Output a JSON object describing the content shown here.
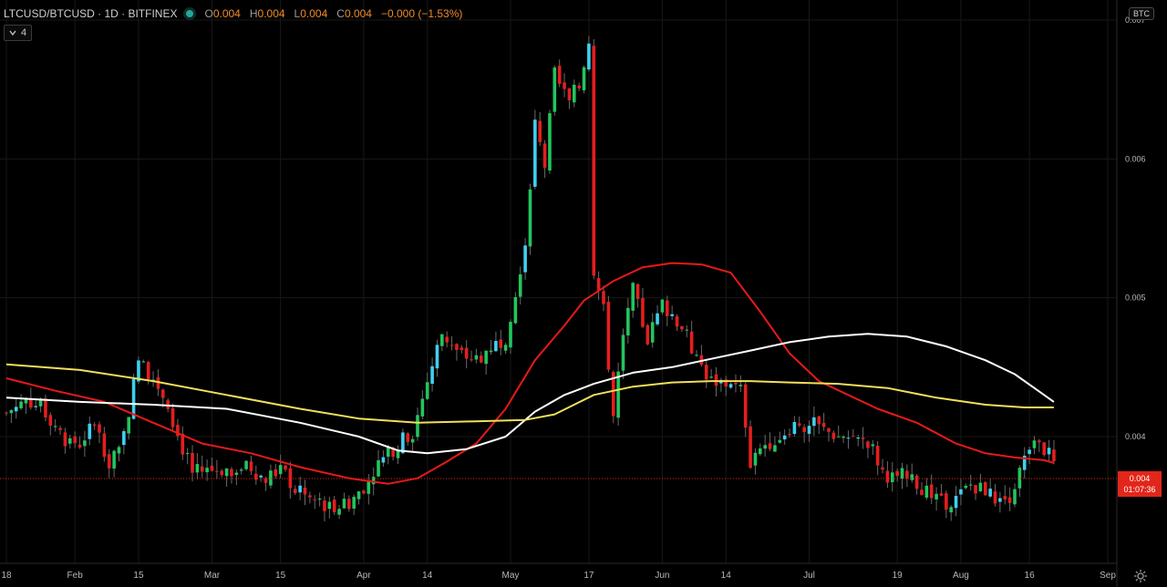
{
  "header": {
    "symbol": "LTCUSD/BTCUSD · 1D · BITFINEX",
    "ohlc": [
      {
        "label": "O",
        "value": "0.004"
      },
      {
        "label": "H",
        "value": "0.004"
      },
      {
        "label": "L",
        "value": "0.004"
      },
      {
        "label": "C",
        "value": "0.004"
      }
    ],
    "change": "−0.000 (−1.53%)"
  },
  "indicator_toggle": {
    "count": "4"
  },
  "currency_badge": "BTC",
  "last_price": {
    "price": "0.004",
    "countdown": "01:07:36"
  },
  "colors": {
    "up": "#22c55e",
    "down": "#e41e1e",
    "up_alt": "#3fd0f0",
    "ma_red": "#e81919",
    "ma_white": "#ffffff",
    "ma_yellow": "#f1df5a",
    "grid": "#181818",
    "axis_text": "#b8b8b8"
  },
  "chart_data": {
    "type": "candlestick",
    "y_axis": {
      "ticks": [
        {
          "value": 0.007,
          "label": "0.007"
        },
        {
          "value": 0.006,
          "label": "0.006"
        },
        {
          "value": 0.005,
          "label": "0.005"
        },
        {
          "value": 0.004,
          "label": "0.004"
        }
      ],
      "range": [
        0.0032,
        0.007
      ],
      "scale": "linear"
    },
    "x_axis": {
      "ticks": [
        {
          "day": 0,
          "label": "18"
        },
        {
          "day": 14,
          "label": "Feb"
        },
        {
          "day": 27,
          "label": "15"
        },
        {
          "day": 42,
          "label": "Mar"
        },
        {
          "day": 56,
          "label": "15"
        },
        {
          "day": 73,
          "label": "Apr"
        },
        {
          "day": 86,
          "label": "14"
        },
        {
          "day": 103,
          "label": "May"
        },
        {
          "day": 119,
          "label": "17"
        },
        {
          "day": 134,
          "label": "Jun"
        },
        {
          "day": 147,
          "label": "14"
        },
        {
          "day": 164,
          "label": "Jul"
        },
        {
          "day": 182,
          "label": "19"
        },
        {
          "day": 195,
          "label": "Aug"
        },
        {
          "day": 209,
          "label": "16"
        },
        {
          "day": 225,
          "label": "Sep"
        }
      ]
    },
    "close_path": [
      [
        0,
        0.00417
      ],
      [
        4,
        0.00428
      ],
      [
        8,
        0.00418
      ],
      [
        12,
        0.00398
      ],
      [
        15,
        0.00395
      ],
      [
        18,
        0.0041
      ],
      [
        21,
        0.00382
      ],
      [
        24,
        0.00402
      ],
      [
        27,
        0.00455
      ],
      [
        30,
        0.00442
      ],
      [
        33,
        0.00425
      ],
      [
        35,
        0.004
      ],
      [
        38,
        0.00375
      ],
      [
        42,
        0.00376
      ],
      [
        46,
        0.00377
      ],
      [
        50,
        0.00378
      ],
      [
        53,
        0.00368
      ],
      [
        56,
        0.00378
      ],
      [
        59,
        0.00362
      ],
      [
        62,
        0.00355
      ],
      [
        66,
        0.0035
      ],
      [
        70,
        0.00352
      ],
      [
        73,
        0.00365
      ],
      [
        76,
        0.0038
      ],
      [
        80,
        0.00395
      ],
      [
        83,
        0.00403
      ],
      [
        86,
        0.0044
      ],
      [
        89,
        0.00475
      ],
      [
        92,
        0.0046
      ],
      [
        96,
        0.00455
      ],
      [
        99,
        0.00465
      ],
      [
        102,
        0.00472
      ],
      [
        104,
        0.00505
      ],
      [
        106,
        0.0054
      ],
      [
        108,
        0.00625
      ],
      [
        110,
        0.00595
      ],
      [
        112,
        0.0066
      ],
      [
        115,
        0.0064
      ],
      [
        117,
        0.00655
      ],
      [
        119,
        0.00685
      ],
      [
        120,
        0.0052
      ],
      [
        122,
        0.0049
      ],
      [
        124,
        0.00415
      ],
      [
        126,
        0.00475
      ],
      [
        128,
        0.00505
      ],
      [
        131,
        0.0047
      ],
      [
        134,
        0.00495
      ],
      [
        138,
        0.0048
      ],
      [
        141,
        0.00455
      ],
      [
        144,
        0.0044
      ],
      [
        147,
        0.00438
      ],
      [
        150,
        0.00435
      ],
      [
        152,
        0.0038
      ],
      [
        155,
        0.00395
      ],
      [
        158,
        0.004
      ],
      [
        161,
        0.0041
      ],
      [
        165,
        0.00408
      ],
      [
        170,
        0.004
      ],
      [
        174,
        0.00398
      ],
      [
        177,
        0.0039
      ],
      [
        179,
        0.00375
      ],
      [
        182,
        0.00368
      ],
      [
        184,
        0.00375
      ],
      [
        188,
        0.0036
      ],
      [
        191,
        0.00352
      ],
      [
        194,
        0.00355
      ],
      [
        197,
        0.00365
      ],
      [
        200,
        0.00362
      ],
      [
        203,
        0.00352
      ],
      [
        205,
        0.00358
      ],
      [
        207,
        0.00375
      ],
      [
        209,
        0.00392
      ],
      [
        211,
        0.00392
      ],
      [
        213,
        0.00388
      ],
      [
        214,
        0.00385
      ]
    ],
    "moving_averages": [
      {
        "color_key": "ma_red",
        "points": [
          [
            0,
            0.00442
          ],
          [
            10,
            0.00433
          ],
          [
            20,
            0.00425
          ],
          [
            30,
            0.0041
          ],
          [
            40,
            0.00395
          ],
          [
            50,
            0.00388
          ],
          [
            60,
            0.00378
          ],
          [
            70,
            0.0037
          ],
          [
            78,
            0.00366
          ],
          [
            84,
            0.0037
          ],
          [
            90,
            0.00382
          ],
          [
            96,
            0.00395
          ],
          [
            102,
            0.0042
          ],
          [
            108,
            0.00455
          ],
          [
            114,
            0.0048
          ],
          [
            118,
            0.00498
          ],
          [
            124,
            0.00512
          ],
          [
            130,
            0.00522
          ],
          [
            136,
            0.00525
          ],
          [
            142,
            0.00524
          ],
          [
            148,
            0.00518
          ],
          [
            154,
            0.0049
          ],
          [
            160,
            0.0046
          ],
          [
            166,
            0.0044
          ],
          [
            172,
            0.0043
          ],
          [
            178,
            0.0042
          ],
          [
            186,
            0.0041
          ],
          [
            194,
            0.00395
          ],
          [
            200,
            0.00388
          ],
          [
            206,
            0.00385
          ],
          [
            212,
            0.00383
          ],
          [
            214,
            0.00381
          ]
        ]
      },
      {
        "color_key": "ma_white",
        "points": [
          [
            0,
            0.00428
          ],
          [
            15,
            0.00425
          ],
          [
            30,
            0.00423
          ],
          [
            45,
            0.0042
          ],
          [
            60,
            0.0041
          ],
          [
            72,
            0.004
          ],
          [
            80,
            0.0039
          ],
          [
            86,
            0.00388
          ],
          [
            94,
            0.00391
          ],
          [
            102,
            0.004
          ],
          [
            108,
            0.00418
          ],
          [
            114,
            0.0043
          ],
          [
            120,
            0.00438
          ],
          [
            128,
            0.00446
          ],
          [
            136,
            0.0045
          ],
          [
            144,
            0.00456
          ],
          [
            152,
            0.00462
          ],
          [
            160,
            0.00468
          ],
          [
            168,
            0.00472
          ],
          [
            176,
            0.00474
          ],
          [
            184,
            0.00472
          ],
          [
            192,
            0.00465
          ],
          [
            200,
            0.00455
          ],
          [
            206,
            0.00445
          ],
          [
            212,
            0.0043
          ],
          [
            214,
            0.00425
          ]
        ]
      },
      {
        "color_key": "ma_yellow",
        "points": [
          [
            0,
            0.00452
          ],
          [
            15,
            0.00448
          ],
          [
            30,
            0.0044
          ],
          [
            45,
            0.0043
          ],
          [
            60,
            0.0042
          ],
          [
            72,
            0.00413
          ],
          [
            84,
            0.0041
          ],
          [
            96,
            0.00411
          ],
          [
            106,
            0.00412
          ],
          [
            112,
            0.00416
          ],
          [
            120,
            0.0043
          ],
          [
            128,
            0.00436
          ],
          [
            136,
            0.00439
          ],
          [
            144,
            0.0044
          ],
          [
            152,
            0.0044
          ],
          [
            160,
            0.00439
          ],
          [
            170,
            0.00438
          ],
          [
            180,
            0.00435
          ],
          [
            190,
            0.00428
          ],
          [
            200,
            0.00423
          ],
          [
            208,
            0.00421
          ],
          [
            214,
            0.00421
          ]
        ]
      }
    ]
  }
}
